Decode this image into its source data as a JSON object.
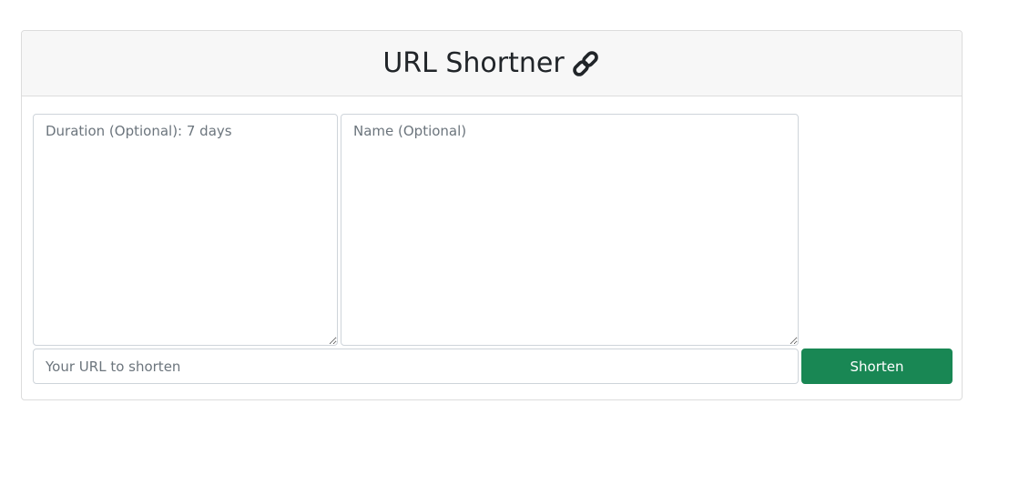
{
  "header": {
    "title": "URL Shortner",
    "icon": "link-icon"
  },
  "form": {
    "duration_placeholder": "Duration (Optional): 7 days",
    "name_placeholder": "Name (Optional)",
    "url_placeholder": "Your URL to shorten",
    "submit_label": "Shorten"
  },
  "colors": {
    "header_bg": "#f7f7f7",
    "button_bg": "#198754",
    "button_text": "#ffffff",
    "border": "#dcdcdc"
  }
}
